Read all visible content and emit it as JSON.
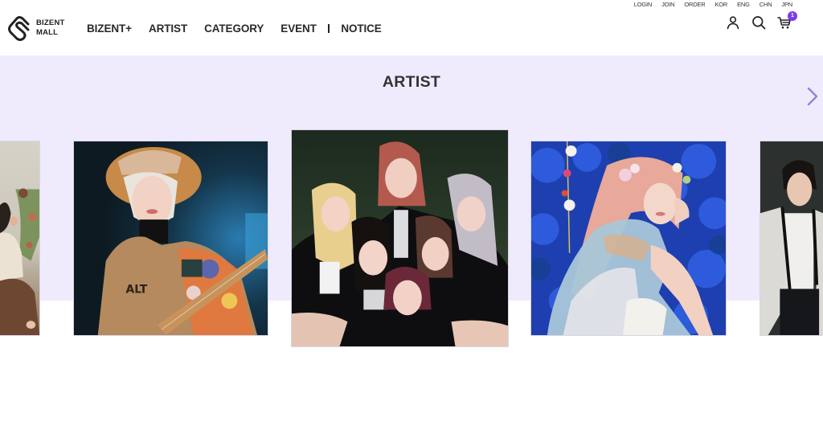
{
  "brand": {
    "name_line1": "BIZENT",
    "name_line2": "MALL",
    "logo_icon": "heart-link-logo-icon"
  },
  "nav": {
    "items": [
      {
        "label": "BIZENT+"
      },
      {
        "label": "ARTIST"
      },
      {
        "label": "CATEGORY"
      },
      {
        "label": "EVENT"
      },
      {
        "label": "NOTICE"
      }
    ]
  },
  "utility_links": [
    {
      "label": "LOGIN"
    },
    {
      "label": "JOIN"
    },
    {
      "label": "ORDER"
    },
    {
      "label": "KOR"
    },
    {
      "label": "ENG"
    },
    {
      "label": "CHN"
    },
    {
      "label": "JPN"
    }
  ],
  "header_icons": {
    "account": "user-icon",
    "search": "search-icon",
    "cart": "cart-icon",
    "cart_count": "1"
  },
  "artist_section": {
    "title": "ARTIST",
    "next_icon": "chevron-right-icon",
    "cards": [
      {
        "alt": "Artist photo with flowers (partially visible)"
      },
      {
        "alt": "Artist with guitar wearing tan jacket and fur hat"
      },
      {
        "alt": "Six-member girl group in black leather jackets"
      },
      {
        "alt": "Artist with pink hair among blue flowers"
      },
      {
        "alt": "Artist in tweed jacket (partially visible)"
      }
    ]
  },
  "colors": {
    "accent": "#7c3aed",
    "band_background": "#efebfd",
    "arrow": "#9b7fd0",
    "text": "#2a2a2a"
  }
}
